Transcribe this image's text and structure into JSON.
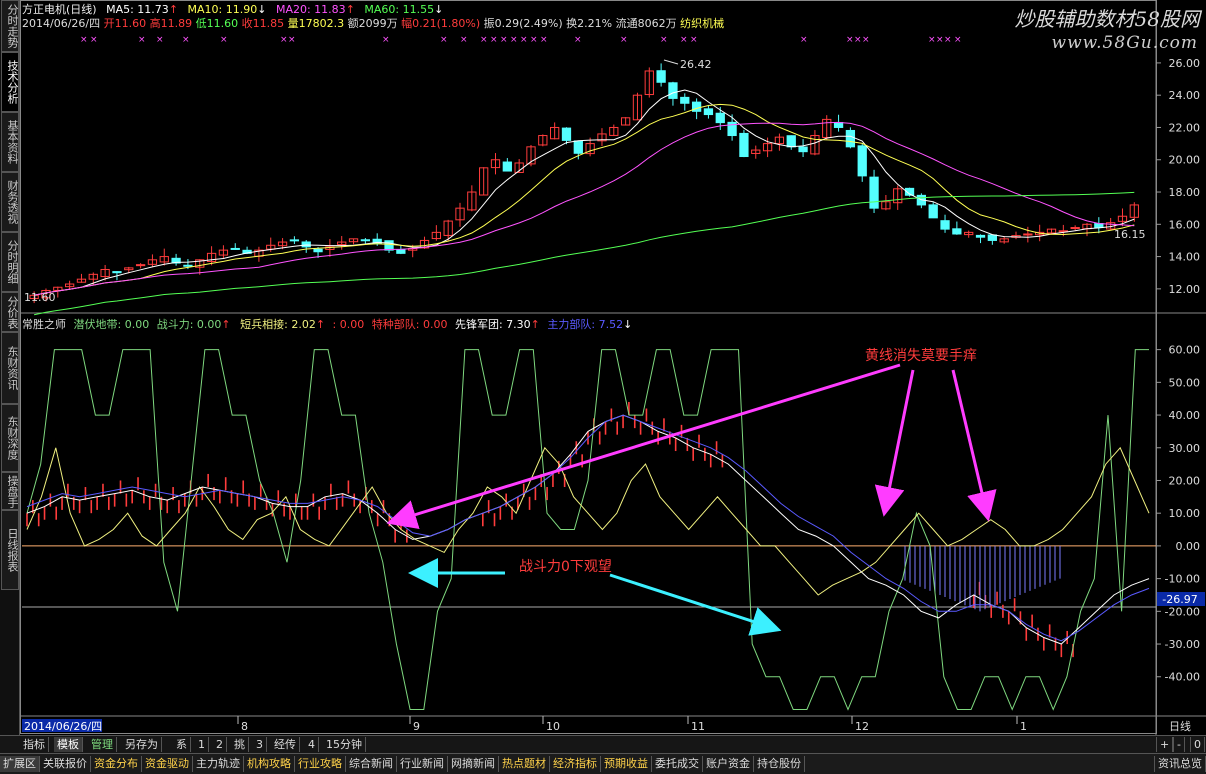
{
  "sidebar": {
    "tabs": [
      "分时走势",
      "技术分析",
      "基本资料",
      "财务透视",
      "分时明细",
      "分价表",
      "东财资讯",
      "东财深度",
      "操盘手",
      "日线报表"
    ]
  },
  "watermark": {
    "line1": "炒股辅助数材58股网",
    "line2": "www.58Gu.com"
  },
  "header": {
    "name": "方正电机(日线)",
    "ma5": "MA5: 11.73",
    "ma10": "MA10: 11.90",
    "ma20": "MA20: 11.83",
    "ma60": "MA60: 11.55",
    "date": "2014/06/26/四",
    "open": "开11.60",
    "high": "高11.89",
    "low": "低11.60",
    "close": "收11.85",
    "vol": "量17802.3",
    "amount": "额2099万",
    "change": "幅0.21(1.80%)",
    "amp": "振0.29(2.49%)",
    "turnover": "换2.21%",
    "float": "流通8062万",
    "industry": "纺织机械"
  },
  "indicator_header": {
    "name": "常胜之师",
    "a": "潜伏地带: 0.00",
    "b": "战斗力: 0.00",
    "c": "短兵相接: 2.02",
    "d": ": 0.00",
    "e": "特种部队: 0.00",
    "f": "先锋军团: 7.30",
    "g": "主力部队: 7.52"
  },
  "annotations": {
    "top_text": "黄线消失莫要手痒",
    "mid_text": "战斗力0下观望"
  },
  "price_labels": {
    "high": "26.42",
    "low": "11.60",
    "current": "16.15"
  },
  "indicator_current": "-26.97",
  "xaxis": {
    "date_box": "2014/06/26/四",
    "months": [
      "8",
      "9",
      "10",
      "11",
      "12",
      "1"
    ],
    "period": "日线"
  },
  "bottom_tabs": [
    "指标",
    "模板",
    "管理",
    "另存为",
    "系",
    "1",
    "2",
    "挑",
    "3",
    "经传",
    "4",
    "15分钟"
  ],
  "bottom_right": [
    "+",
    "-",
    "0"
  ],
  "category_tabs": [
    "扩展区",
    "关联报价",
    "资金分布",
    "资金驱动",
    "主力轨迹",
    "机构攻略",
    "行业攻略",
    "综合新闻",
    "行业新闻",
    "网摘新闻",
    "热点题材",
    "经济指标",
    "预期收益",
    "委托成交",
    "账户资金",
    "持仓股份"
  ],
  "category_right": "资讯总览",
  "colors": {
    "up": "#ff3c3c",
    "down": "#54ffff",
    "ma5": "#ffffff",
    "ma10": "#ffff54",
    "ma20": "#ff54ff",
    "ma60": "#54ff54",
    "blue": "#5a5aff"
  },
  "chart_data": [
    {
      "type": "candlestick",
      "title": "方正电机(日线)",
      "ylim": [
        11,
        26.8
      ],
      "yticks": [
        12,
        14,
        16,
        18,
        20,
        22,
        24,
        26
      ],
      "ytick_labels": [
        "12.00",
        "14.00",
        "16.00",
        "18.00",
        "20.00",
        "22.00",
        "24.00",
        "26.00"
      ],
      "x_months": [
        "8",
        "9",
        "10",
        "11",
        "12",
        "1"
      ],
      "close_path": [
        11.6,
        11.9,
        12.1,
        12.3,
        12.6,
        12.9,
        13.2,
        13.0,
        13.3,
        13.5,
        13.8,
        14.0,
        13.6,
        13.4,
        13.8,
        14.2,
        14.4,
        14.5,
        14.2,
        14.4,
        14.7,
        14.9,
        15.0,
        14.6,
        14.3,
        14.6,
        14.9,
        15.1,
        15.0,
        14.8,
        14.4,
        14.2,
        14.5,
        15.0,
        15.5,
        16.2,
        17.0,
        18.0,
        19.5,
        20.0,
        19.3,
        19.8,
        20.8,
        21.5,
        22.0,
        21.2,
        20.4,
        21.0,
        21.6,
        22.0,
        22.6,
        24.0,
        25.5,
        24.8,
        23.8,
        23.5,
        23.0,
        22.8,
        22.3,
        21.5,
        20.2,
        20.6,
        21.0,
        21.4,
        20.8,
        20.5,
        21.5,
        22.5,
        22.0,
        20.8,
        19.0,
        17.0,
        17.4,
        18.2,
        17.8,
        17.2,
        16.4,
        15.7,
        15.4,
        15.5,
        15.2,
        15.0,
        15.1,
        15.3,
        15.4,
        15.5,
        15.7,
        15.6,
        15.8,
        16.0,
        15.8,
        16.1,
        16.5,
        17.2
      ],
      "ma_series": [
        {
          "name": "MA5",
          "color": "#ffffff"
        },
        {
          "name": "MA10",
          "color": "#ffff54"
        },
        {
          "name": "MA20",
          "color": "#ff54ff"
        },
        {
          "name": "MA60",
          "color": "#54ff54"
        }
      ]
    },
    {
      "type": "line",
      "title": "常胜之师",
      "ylim": [
        -52,
        66
      ],
      "yticks": [
        60,
        50,
        40,
        30,
        20,
        10,
        0,
        -10,
        -20,
        -30,
        -40
      ],
      "ytick_labels": [
        "60.00",
        "50.00",
        "40.00",
        "30.00",
        "20.00",
        "10.00",
        "0.00",
        "-10.00",
        "-20.00",
        "-30.00",
        "-40.00"
      ],
      "series": [
        {
          "name": "战斗力",
          "color": "#7fd87f",
          "values": [
            10,
            25,
            60,
            60,
            60,
            40,
            40,
            60,
            60,
            60,
            -5,
            -20,
            20,
            60,
            60,
            40,
            40,
            20,
            10,
            -5,
            20,
            60,
            60,
            40,
            40,
            10,
            -5,
            -30,
            -50,
            -50,
            -20,
            -10,
            60,
            60,
            40,
            40,
            60,
            60,
            10,
            5,
            5,
            20,
            60,
            60,
            40,
            40,
            60,
            60,
            40,
            40,
            60,
            60,
            60,
            -30,
            -40,
            -40,
            -50,
            -50,
            -40,
            -40,
            -50,
            -40,
            -40,
            -20,
            -10,
            10,
            0,
            -40,
            -50,
            -50,
            -40,
            -40,
            -50,
            -40,
            -40,
            -50,
            -40,
            -20,
            -10,
            40,
            -20,
            60,
            60
          ]
        },
        {
          "name": "短兵相接",
          "color": "#f0f080",
          "values": [
            5,
            15,
            30,
            10,
            0,
            2,
            5,
            10,
            3,
            0,
            5,
            10,
            18,
            12,
            5,
            2,
            8,
            10,
            15,
            5,
            2,
            0,
            6,
            12,
            18,
            10,
            5,
            2,
            0,
            -2,
            5,
            10,
            18,
            15,
            10,
            20,
            30,
            25,
            15,
            10,
            5,
            10,
            20,
            25,
            15,
            10,
            5,
            10,
            15,
            10,
            5,
            0,
            0,
            -5,
            -10,
            -15,
            -12,
            -10,
            -8,
            -5,
            0,
            5,
            10,
            5,
            0,
            2,
            5,
            8,
            5,
            0,
            0,
            2,
            5,
            10,
            15,
            25,
            30,
            20,
            10
          ]
        },
        {
          "name": "主力部队",
          "color": "#ffffff",
          "values": [
            10,
            12,
            15,
            14,
            15,
            16,
            17,
            15,
            14,
            16,
            18,
            17,
            16,
            15,
            13,
            12,
            12,
            15,
            16,
            14,
            10,
            5,
            2,
            3,
            5,
            8,
            10,
            12,
            15,
            18,
            22,
            28,
            35,
            38,
            40,
            38,
            35,
            33,
            30,
            28,
            25,
            20,
            15,
            10,
            5,
            3,
            0,
            -5,
            -10,
            -12,
            -15,
            -20,
            -22,
            -18,
            -15,
            -18,
            -20,
            -25,
            -28,
            -30,
            -25,
            -20,
            -15,
            -12,
            -10
          ]
        },
        {
          "name": "先锋军团",
          "color": "#5a5aff",
          "values": [
            12,
            14,
            16,
            15,
            16,
            17,
            18,
            17,
            16,
            15,
            16,
            17,
            16,
            15,
            14,
            13,
            13,
            14,
            15,
            14,
            12,
            8,
            4,
            3,
            5,
            8,
            10,
            12,
            15,
            18,
            22,
            27,
            33,
            38,
            40,
            38,
            36,
            34,
            32,
            30,
            27,
            23,
            18,
            13,
            9,
            6,
            3,
            -2,
            -6,
            -10,
            -13,
            -17,
            -20,
            -20,
            -18,
            -18,
            -20,
            -24,
            -27,
            -29,
            -26,
            -22,
            -18,
            -15,
            -13
          ]
        }
      ],
      "bars_up_color": "#ff3c3c",
      "bars_blue_color": "#7d7dff"
    }
  ]
}
